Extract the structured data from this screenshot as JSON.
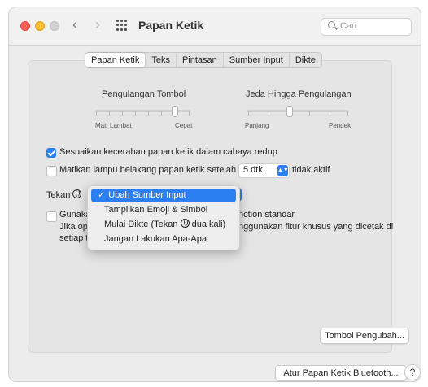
{
  "window": {
    "title": "Papan Ketik"
  },
  "search": {
    "placeholder": "Cari"
  },
  "tabs": [
    {
      "label": "Papan Ketik",
      "active": true
    },
    {
      "label": "Teks",
      "active": false
    },
    {
      "label": "Pintasan",
      "active": false
    },
    {
      "label": "Sumber Input",
      "active": false
    },
    {
      "label": "Dikte",
      "active": false
    }
  ],
  "key_repeat": {
    "label": "Pengulangan Tombol",
    "min_label": "Mati",
    "low_label": "Lambat",
    "high_label": "Cepat"
  },
  "delay_until_repeat": {
    "label": "Jeda Hingga Pengulangan",
    "low_label": "Panjang",
    "high_label": "Pendek"
  },
  "adjust_brightness": {
    "label": "Sesuaikan kecerahan papan ketik dalam cahaya redup",
    "checked": true
  },
  "backlight_off": {
    "label": "Matikan lampu belakang papan ketik setelah",
    "value": "5 dtk",
    "suffix": "tidak aktif",
    "checked": false
  },
  "fn_key": {
    "prefix": "Tekan"
  },
  "fn_menu": {
    "items": [
      {
        "label": "Ubah Sumber Input",
        "selected": true
      },
      {
        "label": "Tampilkan Emoji & Simbol",
        "selected": false
      },
      {
        "label": "Mulai Dikte (Tekan",
        "suffix": "dua kali)",
        "selected": false
      },
      {
        "label": "Jangan Lakukan Apa-Apa",
        "selected": false
      }
    ]
  },
  "function_keys": {
    "label_start": "Gunaka",
    "label_end": "nction standar",
    "desc_start": "Jika op",
    "desc_end": "nggunakan fitur khusus yang dicetak di",
    "desc_line2": "setiap t",
    "checked": false
  },
  "buttons": {
    "modifier_keys": "Tombol Pengubah...",
    "bluetooth": "Atur Papan Ketik Bluetooth...",
    "help": "?"
  },
  "colors": {
    "accent": "#2b7ff0"
  }
}
